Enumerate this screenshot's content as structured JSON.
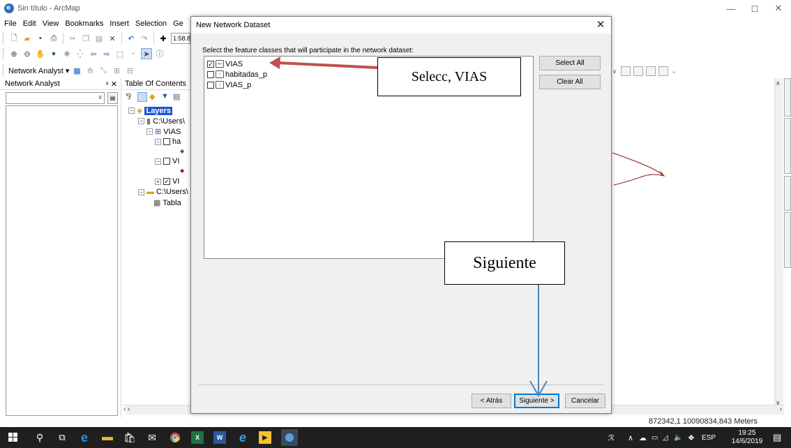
{
  "window": {
    "title": "Sin título - ArcMap",
    "controls": {
      "minimize": "—",
      "maximize": "◻",
      "close": "✕"
    }
  },
  "menu": [
    "File",
    "Edit",
    "View",
    "Bookmarks",
    "Insert",
    "Selection",
    "Ge"
  ],
  "toolbar": {
    "scale": "1:58.8"
  },
  "network_analyst_toolbar": {
    "label": "Network Analyst ▾"
  },
  "network_analyst_pane": {
    "title": "Network Analyst",
    "pin": "⁴ ✕"
  },
  "toc": {
    "title": "Table Of Contents",
    "items": {
      "layers": "Layers",
      "users_path": "C:\\Users\\",
      "vias_dataset": "VIAS",
      "ha": "ha",
      "vi1": "VI",
      "vi2": "VI",
      "users_folder": "C:\\Users\\",
      "tabla": "Tabla"
    }
  },
  "dialog": {
    "title": "New Network Dataset",
    "close": "✕",
    "instruction": "Select the feature classes that will participate in the network dataset:",
    "feature_classes": [
      {
        "label": "VIAS",
        "checked": true,
        "icon": "line-feature-icon"
      },
      {
        "label": "habitadas_p",
        "checked": false,
        "icon": "point-feature-icon"
      },
      {
        "label": "VIAS_p",
        "checked": false,
        "icon": "point-feature-icon"
      }
    ],
    "buttons": {
      "select_all": "Select All",
      "clear_all": "Clear All",
      "back": "< Atrás",
      "next": "Siguiente >",
      "cancel": "Cancelar"
    }
  },
  "annotations": {
    "callout_vias": "Selecc, VIAS",
    "callout_next": "Siguiente",
    "arrow_color": "#c0504d",
    "arrow_blue": "#4f81bd"
  },
  "status": {
    "coordinates": "872342,1  10090834,843 Meters"
  },
  "taskbar": {
    "time": "19:25",
    "date": "14/6/2019",
    "language": "ESP"
  },
  "colors": {
    "selection_blue": "#1b55d6",
    "taskbar": "#1f1f1f",
    "dialog_bg": "#f0f0f0"
  }
}
